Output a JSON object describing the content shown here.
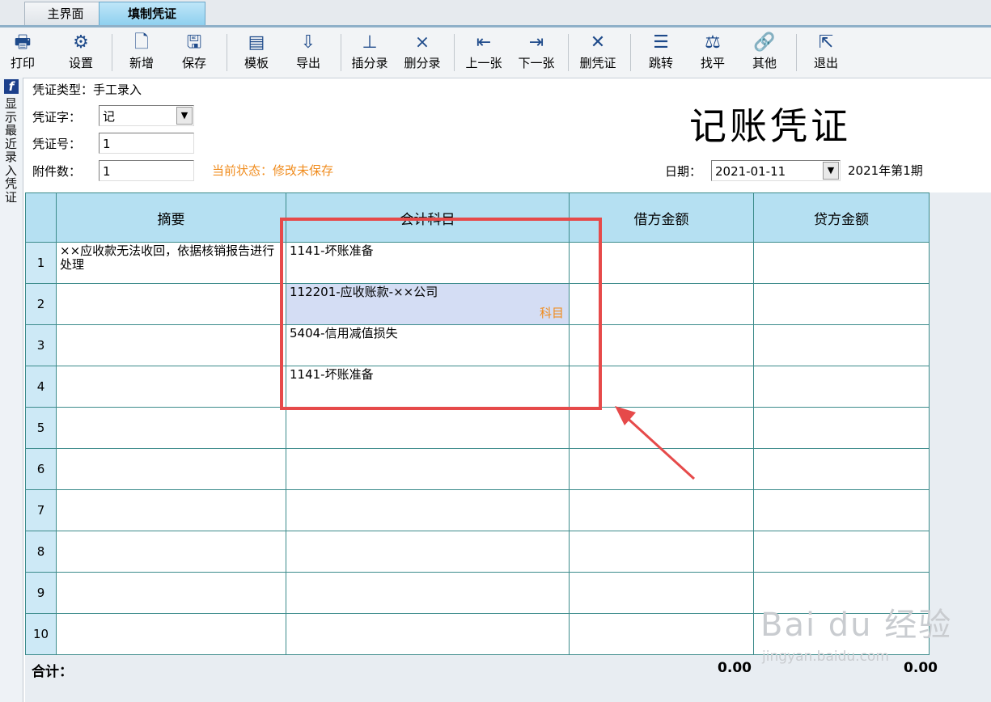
{
  "tabs": [
    {
      "label": "主界面"
    },
    {
      "label": "填制凭证"
    }
  ],
  "toolbar": [
    {
      "label": "打印",
      "icon": "printer-icon"
    },
    {
      "label": "设置",
      "icon": "settings-icon"
    },
    {
      "label": "新增",
      "icon": "new-doc-icon"
    },
    {
      "label": "保存",
      "icon": "save-icon"
    },
    {
      "label": "模板",
      "icon": "template-icon"
    },
    {
      "label": "导出",
      "icon": "export-icon"
    },
    {
      "label": "插分录",
      "icon": "insert-row-icon"
    },
    {
      "label": "删分录",
      "icon": "delete-row-icon"
    },
    {
      "label": "上一张",
      "icon": "prev-icon"
    },
    {
      "label": "下一张",
      "icon": "next-icon"
    },
    {
      "label": "删凭证",
      "icon": "delete-voucher-icon"
    },
    {
      "label": "跳转",
      "icon": "jump-icon"
    },
    {
      "label": "找平",
      "icon": "balance-icon"
    },
    {
      "label": "其他",
      "icon": "link-icon"
    },
    {
      "label": "退出",
      "icon": "exit-icon"
    }
  ],
  "side": {
    "f": "f",
    "text": "显示最近录入凭证"
  },
  "header": {
    "type_label": "凭证类型：手工录入",
    "word_label": "凭证字：",
    "word_value": "记",
    "number_label": "凭证号：",
    "number_value": "1",
    "attach_label": "附件数：",
    "attach_value": "1",
    "status": "当前状态：修改未保存",
    "title": "记账凭证",
    "date_label": "日期：",
    "date_value": "2021-01-11",
    "period": "2021年第1期"
  },
  "table": {
    "headers": [
      "摘要",
      "会计科目",
      "借方金额",
      "贷方金额"
    ],
    "rows": [
      {
        "no": "1",
        "summary": "××应收款无法收回，依据核销报告进行处理",
        "account": "1141-坏账准备",
        "debit": "",
        "credit": ""
      },
      {
        "no": "2",
        "summary": "",
        "account": "112201-应收账款-××公司",
        "debit": "",
        "credit": "",
        "hint": "科目"
      },
      {
        "no": "3",
        "summary": "",
        "account": "5404-信用减值损失",
        "debit": "",
        "credit": ""
      },
      {
        "no": "4",
        "summary": "",
        "account": "1141-坏账准备",
        "debit": "",
        "credit": ""
      },
      {
        "no": "5",
        "summary": "",
        "account": "",
        "debit": "",
        "credit": ""
      },
      {
        "no": "6",
        "summary": "",
        "account": "",
        "debit": "",
        "credit": ""
      },
      {
        "no": "7",
        "summary": "",
        "account": "",
        "debit": "",
        "credit": ""
      },
      {
        "no": "8",
        "summary": "",
        "account": "",
        "debit": "",
        "credit": ""
      },
      {
        "no": "9",
        "summary": "",
        "account": "",
        "debit": "",
        "credit": ""
      },
      {
        "no": "10",
        "summary": "",
        "account": "",
        "debit": "",
        "credit": ""
      }
    ],
    "total_label": "合计：",
    "total_debit": "0.00",
    "total_credit": "0.00"
  },
  "watermark": {
    "big": "Bai du 经验",
    "small": "jingyan.baidu.com"
  },
  "colors": {
    "status": "#f08c1e",
    "annotation": "#e64a4a",
    "header_bg": "#b5e0f2"
  }
}
